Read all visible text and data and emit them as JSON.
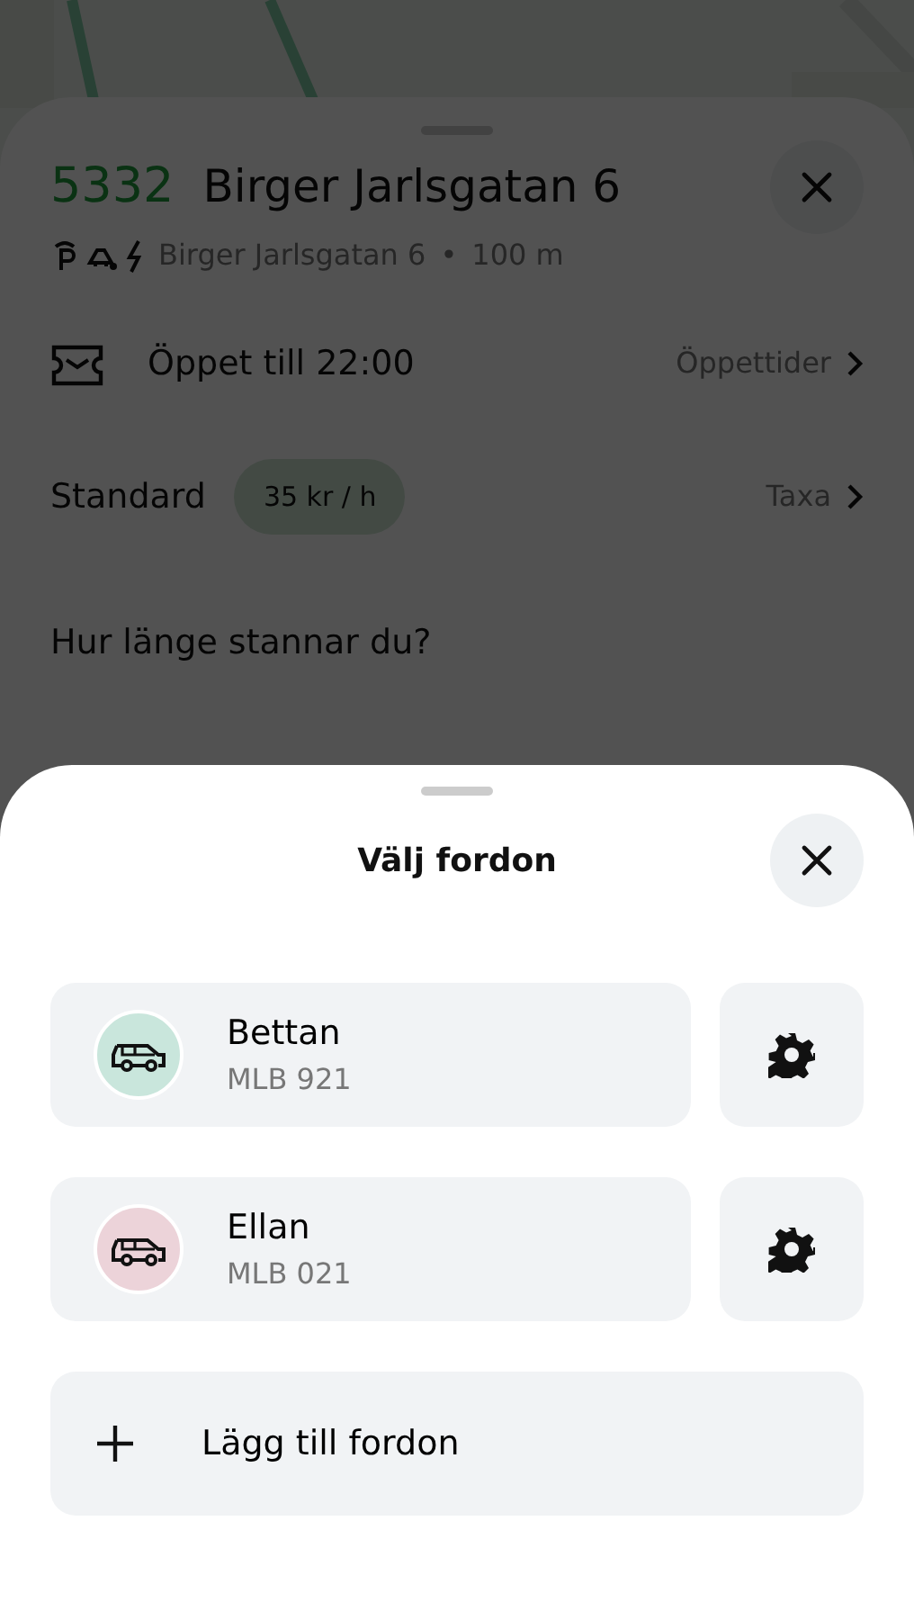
{
  "zone": {
    "code": "5332",
    "title": "Birger Jarlsgatan 6",
    "address": "Birger Jarlsgatan 6",
    "separator": "•",
    "distance": "100 m"
  },
  "hours": {
    "text": "Öppet till 22:00",
    "link": "Öppettider"
  },
  "rate": {
    "label": "Standard",
    "price": "35 kr / h",
    "link": "Taxa"
  },
  "question": "Hur länge stannar du?",
  "sheet": {
    "title": "Välj fordon",
    "vehicles": [
      {
        "name": "Bettan",
        "plate": "MLB 921",
        "color": "#c9e6dc"
      },
      {
        "name": "Ellan",
        "plate": "MLB 021",
        "color": "#ecd3d9"
      }
    ],
    "add": {
      "label": "Lägg till fordon"
    }
  }
}
